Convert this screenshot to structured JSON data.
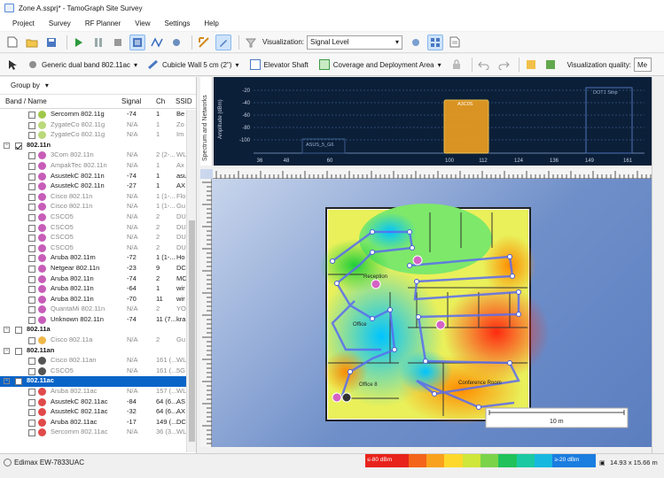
{
  "window": {
    "title": "Zone A.ssprj* - TamoGraph Site Survey"
  },
  "menu": [
    "Project",
    "Survey",
    "RF Planner",
    "View",
    "Settings",
    "Help"
  ],
  "toolbar1": {
    "visualization_label": "Visualization:",
    "visualization_value": "Signal Level"
  },
  "toolbar2": {
    "adapter": "Generic dual band 802.11ac",
    "wall": "Cubicle Wall 5 cm (2\")",
    "elevator": "Elevator Shaft",
    "coverage": "Coverage and Deployment Area",
    "quality_label": "Visualization quality:",
    "quality_value": "Me"
  },
  "left_panel": {
    "groupby": "Group by",
    "columns": {
      "name": "Band / Name",
      "signal": "Signal",
      "ch": "Ch",
      "ssid": "SSID"
    },
    "rows": [
      {
        "kind": "ap",
        "name": "Sercomm 802.11g",
        "signal": "-74",
        "ch": "1",
        "ssid": "Be",
        "color": "#9fc84a",
        "dim": false
      },
      {
        "kind": "ap",
        "name": "ZygateCo 802.11g",
        "signal": "N/A",
        "ch": "1",
        "ssid": "Zo",
        "color": "#b9d97a",
        "dim": true
      },
      {
        "kind": "ap",
        "name": "ZygateCo 802.11g",
        "signal": "N/A",
        "ch": "1",
        "ssid": "Im",
        "color": "#b9d97a",
        "dim": true
      },
      {
        "kind": "group",
        "name": "802.11n",
        "checked": true
      },
      {
        "kind": "ap",
        "name": "3Com 802.11n",
        "signal": "N/A",
        "ch": "2 (2-...",
        "ssid": "WL",
        "color": "#c75db8",
        "dim": true
      },
      {
        "kind": "ap",
        "name": "AmpakTec 802.11n",
        "signal": "N/A",
        "ch": "1",
        "ssid": "Ax",
        "color": "#c75db8",
        "dim": true
      },
      {
        "kind": "ap",
        "name": "AsustekC 802.11n",
        "signal": "-74",
        "ch": "1",
        "ssid": "asu",
        "color": "#c75db8",
        "dim": false
      },
      {
        "kind": "ap",
        "name": "AsustekC 802.11n",
        "signal": "-27",
        "ch": "1",
        "ssid": "AX",
        "color": "#c75db8",
        "dim": false
      },
      {
        "kind": "ap",
        "name": "Cisco 802.11n",
        "signal": "N/A",
        "ch": "1 (1-...",
        "ssid": "Flo",
        "color": "#c75db8",
        "dim": true
      },
      {
        "kind": "ap",
        "name": "Cisco 802.11n",
        "signal": "N/A",
        "ch": "1 (1-...",
        "ssid": "Gu",
        "color": "#c75db8",
        "dim": true
      },
      {
        "kind": "ap",
        "name": "CSCO5",
        "signal": "N/A",
        "ch": "2",
        "ssid": "DU",
        "color": "#c75db8",
        "dim": true
      },
      {
        "kind": "ap",
        "name": "CSCO5",
        "signal": "N/A",
        "ch": "2",
        "ssid": "DU",
        "color": "#c75db8",
        "dim": true
      },
      {
        "kind": "ap",
        "name": "CSCO5",
        "signal": "N/A",
        "ch": "2",
        "ssid": "DU",
        "color": "#c75db8",
        "dim": true
      },
      {
        "kind": "ap",
        "name": "CSCO5",
        "signal": "N/A",
        "ch": "2",
        "ssid": "DU",
        "color": "#c75db8",
        "dim": true
      },
      {
        "kind": "ap",
        "name": "Aruba 802.11m",
        "signal": "-72",
        "ch": "1 (1-...",
        "ssid": "Ho",
        "color": "#c75db8",
        "dim": false
      },
      {
        "kind": "ap",
        "name": "Netgear 802.11n",
        "signal": "-23",
        "ch": "9",
        "ssid": "DC",
        "color": "#c75db8",
        "dim": false
      },
      {
        "kind": "ap",
        "name": "Aruba 802.11n",
        "signal": "-74",
        "ch": "2",
        "ssid": "MC",
        "color": "#c75db8",
        "dim": false
      },
      {
        "kind": "ap",
        "name": "Aruba 802.11n",
        "signal": "-64",
        "ch": "1",
        "ssid": "wir",
        "color": "#c75db8",
        "dim": false
      },
      {
        "kind": "ap",
        "name": "Aruba 802.11n",
        "signal": "-70",
        "ch": "11",
        "ssid": "wir",
        "color": "#c75db8",
        "dim": false
      },
      {
        "kind": "ap",
        "name": "QuantaMi 802.11n",
        "signal": "N/A",
        "ch": "2",
        "ssid": "YO",
        "color": "#c75db8",
        "dim": true
      },
      {
        "kind": "ap",
        "name": "Unknown 802.11n",
        "signal": "-74",
        "ch": "11 (7...",
        "ssid": "kra",
        "color": "#c75db8",
        "dim": false
      },
      {
        "kind": "group",
        "name": "802.11a",
        "checked": false
      },
      {
        "kind": "ap",
        "name": "Cisco 802.11a",
        "signal": "N/A",
        "ch": "2",
        "ssid": "Gu",
        "color": "#f0b84a",
        "dim": true
      },
      {
        "kind": "group",
        "name": "802.11an",
        "checked": false
      },
      {
        "kind": "ap",
        "name": "Cisco 802.11an",
        "signal": "N/A",
        "ch": "161 (...",
        "ssid": "WL",
        "color": "#555555",
        "dim": true
      },
      {
        "kind": "ap",
        "name": "CSCO5",
        "signal": "N/A",
        "ch": "161 (...",
        "ssid": "5G",
        "color": "#555555",
        "dim": true
      },
      {
        "kind": "group",
        "name": "802.11ac",
        "checked": false,
        "selected": true
      },
      {
        "kind": "ap",
        "name": "Aruba 802.11ac",
        "signal": "N/A",
        "ch": "157 (...",
        "ssid": "WL",
        "color": "#e04a4a",
        "dim": true
      },
      {
        "kind": "ap",
        "name": "AsustekC 802.11ac",
        "signal": "-84",
        "ch": "64 (6...",
        "ssid": "AS",
        "color": "#e04a4a",
        "dim": false
      },
      {
        "kind": "ap",
        "name": "AsustekC 802.11ac",
        "signal": "-32",
        "ch": "64 (6...",
        "ssid": "AX",
        "color": "#e04a4a",
        "dim": false
      },
      {
        "kind": "ap",
        "name": "Aruba 802.11ac",
        "signal": "-17",
        "ch": "149 (...",
        "ssid": "DC",
        "color": "#e04a4a",
        "dim": false
      },
      {
        "kind": "ap",
        "name": "Sercomm 802.11ac",
        "signal": "N/A",
        "ch": "36 (3...",
        "ssid": "WL",
        "color": "#e04a4a",
        "dim": true
      }
    ]
  },
  "spectrum": {
    "side_label": "Spectrum and Networks",
    "ylabel": "Amplitude (dBm)",
    "yticks": [
      "-20",
      "-40",
      "-60",
      "-80",
      "-100"
    ],
    "xticks": [
      "36",
      "48",
      "60",
      "100",
      "112",
      "124",
      "136",
      "149",
      "161"
    ],
    "networks": [
      "ASUS_5_G6",
      "A3C0S",
      "DOT1 Strip"
    ]
  },
  "map": {
    "labels": [
      "Reception",
      "Office",
      "Office 8",
      "Conference Room"
    ],
    "scale_label": "10 m"
  },
  "status": {
    "device": "Edimax EW-7833UAC",
    "legend_min": "≤-80 dBm",
    "legend_max": "≥-20 dBm",
    "size": "14.93 x 15.66 m"
  }
}
